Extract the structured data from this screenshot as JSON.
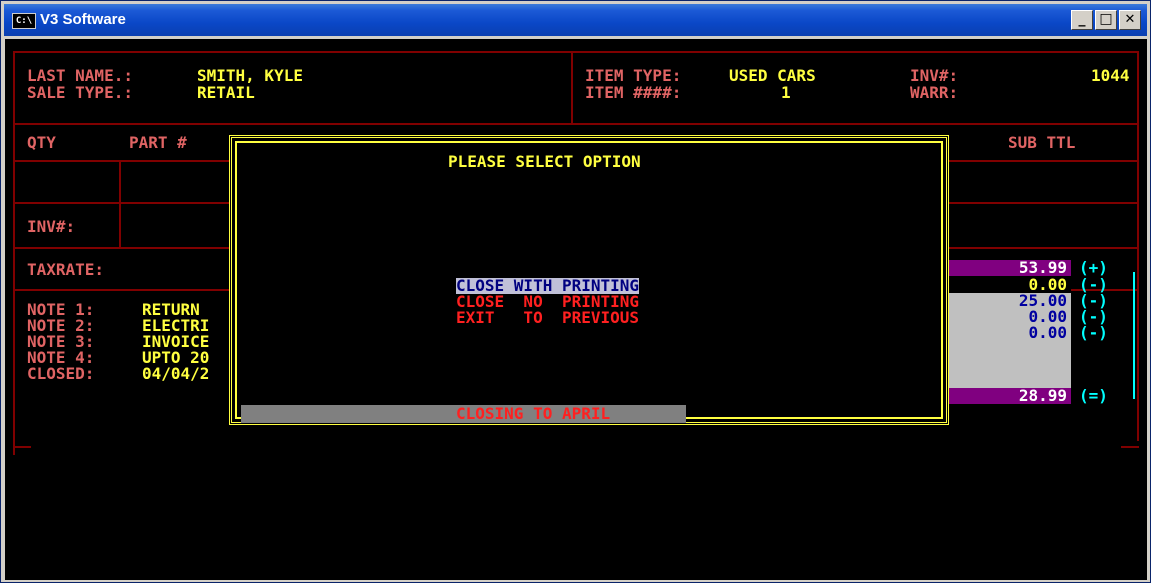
{
  "window": {
    "title": "V3 Software",
    "icon_text": "C:\\",
    "minimize": "_",
    "maximize": "□",
    "close": "✕"
  },
  "header": {
    "last_name_label": "LAST NAME.:",
    "last_name": "SMITH, KYLE",
    "sale_type_label": "SALE TYPE.:",
    "sale_type": "RETAIL",
    "item_type_label": "ITEM TYPE:",
    "item_type": "USED CARS",
    "item_num_label": "ITEM ####:",
    "item_num": "1",
    "inv_label": "INV#:",
    "inv": "1044",
    "warr_label": "WARR:"
  },
  "grid": {
    "qty": "QTY",
    "part": "PART #",
    "subttl": "SUB TTL",
    "inv_label": "INV#:"
  },
  "taxrate_label": "TAXRATE:",
  "notes": [
    {
      "label": "NOTE 1:",
      "value": "RETURN"
    },
    {
      "label": "NOTE 2:",
      "value": "ELECTRI"
    },
    {
      "label": "NOTE 3:",
      "value": "INVOICE"
    },
    {
      "label": "NOTE 4:",
      "value": "UPTO 20"
    }
  ],
  "closed_label": "CLOSED:",
  "closed_value": "04/04/2",
  "totals": [
    {
      "value": "53.99",
      "sym": "(+)",
      "bg": "#800080",
      "fg": "#ffffff"
    },
    {
      "value": "0.00",
      "sym": "(-)",
      "bg": "#000000",
      "fg": "#ffff40"
    },
    {
      "value": "25.00",
      "sym": "(-)",
      "bg": "#c0c0c0",
      "fg": "#0000a0"
    },
    {
      "value": "0.00",
      "sym": "(-)",
      "bg": "#c0c0c0",
      "fg": "#0000a0"
    },
    {
      "value": "0.00",
      "sym": "(-)",
      "bg": "#c0c0c0",
      "fg": "#0000a0"
    },
    {
      "value": "",
      "sym": "",
      "bg": "#c0c0c0",
      "fg": "#0000a0"
    },
    {
      "value": "28.99",
      "sym": "(=)",
      "bg": "#800080",
      "fg": "#ffffff"
    }
  ],
  "dialog": {
    "title": "PLEASE SELECT OPTION",
    "options": [
      "CLOSE WITH PRINTING",
      "CLOSE  NO  PRINTING",
      "EXIT   TO  PREVIOUS"
    ],
    "selected_index": 0,
    "status": "CLOSING TO APRIL"
  },
  "colors": {
    "label": "#e06464",
    "value": "#ffff40",
    "frame": "#800000",
    "highlight_bg": "#c0c0d8",
    "highlight_fg": "#000080",
    "option_fg": "#ff2020",
    "status_bar": "#808080"
  }
}
